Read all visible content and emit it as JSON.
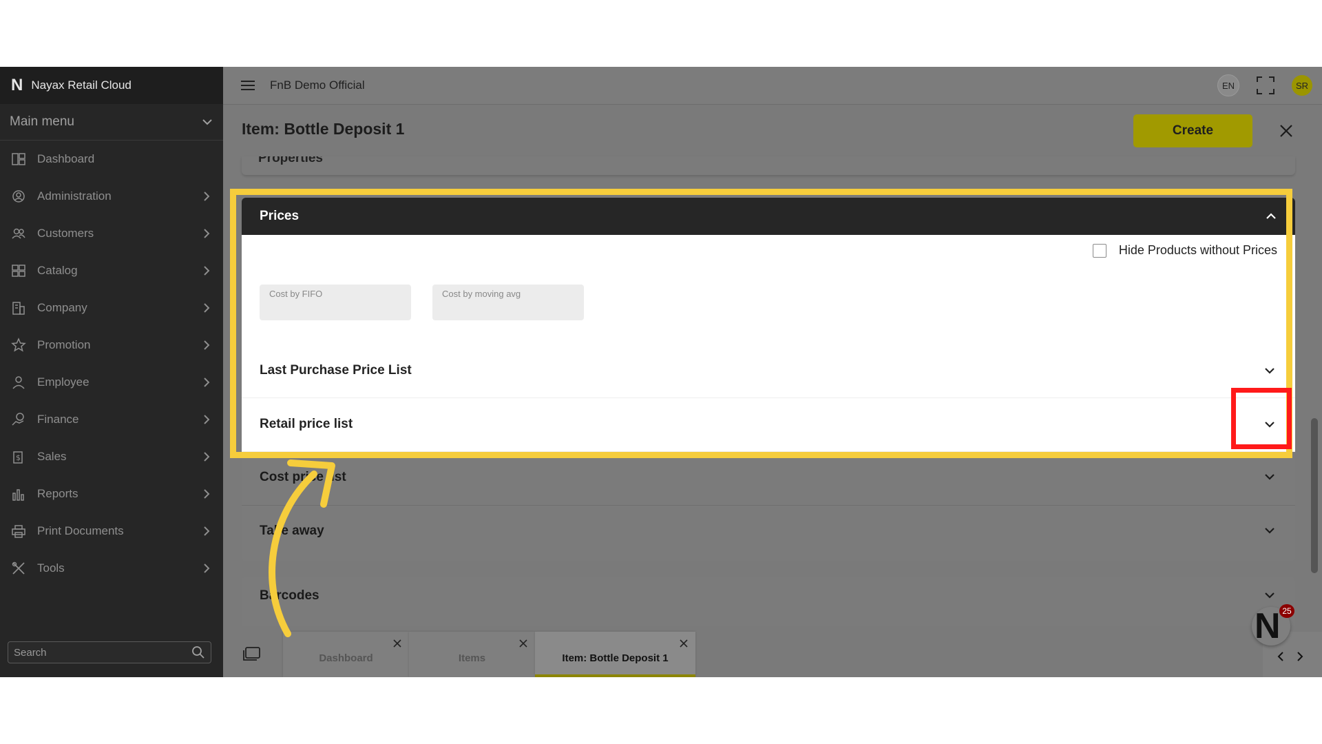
{
  "app": {
    "brand": "Nayax Retail Cloud",
    "company": "FnB Demo Official",
    "language": "EN",
    "user_initials": "SR"
  },
  "sidebar": {
    "main_menu": "Main menu",
    "items": [
      {
        "label": "Dashboard",
        "icon": "dashboard-icon",
        "has_children": false
      },
      {
        "label": "Administration",
        "icon": "admin-icon",
        "has_children": true
      },
      {
        "label": "Customers",
        "icon": "customers-icon",
        "has_children": true
      },
      {
        "label": "Catalog",
        "icon": "catalog-icon",
        "has_children": true
      },
      {
        "label": "Company",
        "icon": "company-icon",
        "has_children": true
      },
      {
        "label": "Promotion",
        "icon": "star-icon",
        "has_children": true
      },
      {
        "label": "Employee",
        "icon": "employee-icon",
        "has_children": true
      },
      {
        "label": "Finance",
        "icon": "finance-icon",
        "has_children": true
      },
      {
        "label": "Sales",
        "icon": "sales-icon",
        "has_children": true
      },
      {
        "label": "Reports",
        "icon": "reports-icon",
        "has_children": true
      },
      {
        "label": "Print Documents",
        "icon": "printer-icon",
        "has_children": true
      },
      {
        "label": "Tools",
        "icon": "tools-icon",
        "has_children": true
      }
    ],
    "search_placeholder": "Search"
  },
  "header": {
    "title": "Item: Bottle Deposit 1",
    "create_label": "Create"
  },
  "sections": {
    "properties": "Properties",
    "prices": {
      "title": "Prices",
      "hide_label": "Hide Products without Prices",
      "hide_checked": false,
      "cost_fifo": "Cost by FIFO",
      "cost_avg": "Cost by moving avg",
      "lists": [
        "Last Purchase Price List",
        "Retail price list",
        "Cost price list",
        "Take away"
      ]
    },
    "barcodes": "Barcodes"
  },
  "tabs": [
    {
      "label": "Dashboard",
      "active": false
    },
    {
      "label": "Items",
      "active": false
    },
    {
      "label": "Item: Bottle Deposit 1",
      "active": true
    }
  ],
  "notifications": {
    "count": "25"
  },
  "colors": {
    "accent": "#a19a00",
    "highlight_yellow": "#f6cd3c",
    "highlight_red": "#ff1a1a",
    "sidebar_bg": "#262626"
  }
}
